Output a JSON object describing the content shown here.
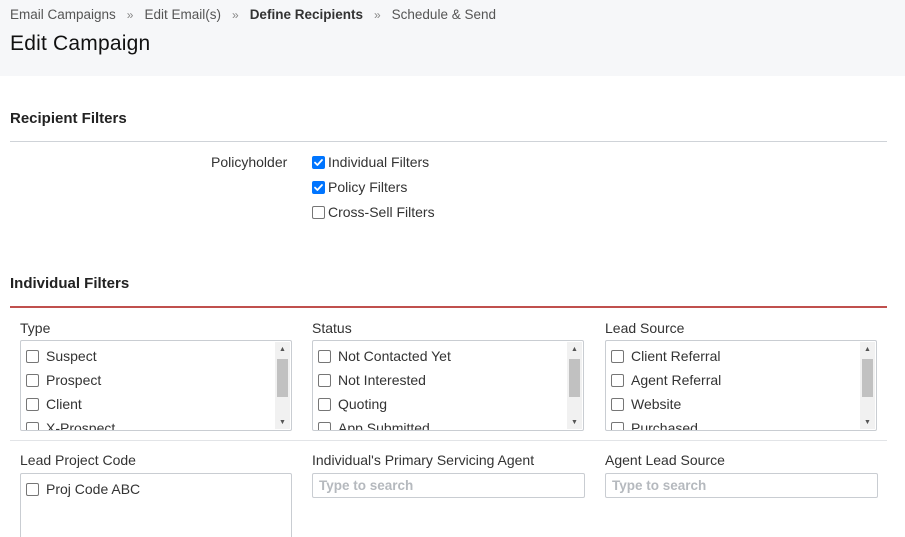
{
  "breadcrumb": {
    "items": [
      "Email Campaigns",
      "Edit Email(s)",
      "Define Recipients",
      "Schedule & Send"
    ],
    "separator": "»"
  },
  "page_title": "Edit Campaign",
  "recipient_filters": {
    "title": "Recipient Filters",
    "policyholder_label": "Policyholder",
    "options": [
      {
        "label": "Individual Filters",
        "checked": true
      },
      {
        "label": "Policy Filters",
        "checked": true
      },
      {
        "label": "Cross-Sell Filters",
        "checked": false
      }
    ]
  },
  "individual_filters": {
    "title": "Individual Filters",
    "type": {
      "label": "Type",
      "items": [
        "Suspect",
        "Prospect",
        "Client",
        "X-Prospect"
      ]
    },
    "status": {
      "label": "Status",
      "items": [
        "Not Contacted Yet",
        "Not Interested",
        "Quoting",
        "App Submitted"
      ]
    },
    "lead_source": {
      "label": "Lead Source",
      "items": [
        "Client Referral",
        "Agent Referral",
        "Website",
        "Purchased"
      ]
    },
    "lead_project_code": {
      "label": "Lead Project Code",
      "items": [
        "Proj Code ABC"
      ]
    },
    "primary_agent": {
      "label": "Individual's Primary Servicing Agent",
      "placeholder": "Type to search"
    },
    "agent_lead_source": {
      "label": "Agent Lead Source",
      "placeholder": "Type to search"
    }
  },
  "colors": {
    "header_bg": "#f6f7f9",
    "checkbox_checked": "#0075ff",
    "section_accent": "#c0504d"
  }
}
